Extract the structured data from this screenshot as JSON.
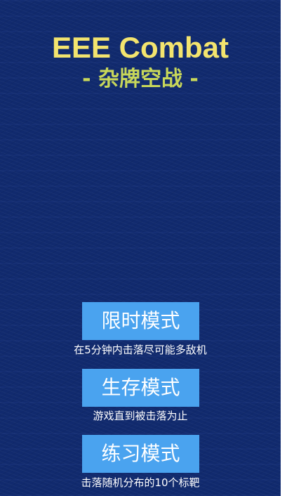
{
  "title": "EEE Combat",
  "subtitle": "- 杂牌空战 -",
  "modes": [
    {
      "label": "限时模式",
      "desc": "在5分钟内击落尽可能多敌机"
    },
    {
      "label": "生存模式",
      "desc": "游戏直到被击落为止"
    },
    {
      "label": "练习模式",
      "desc": "击落随机分布的10个标靶"
    }
  ],
  "colors": {
    "background": "#112a6e",
    "title": "#f3e46e",
    "subtitle": "#c8d75a",
    "button": "#4aa3ef",
    "text": "#ffffff"
  }
}
